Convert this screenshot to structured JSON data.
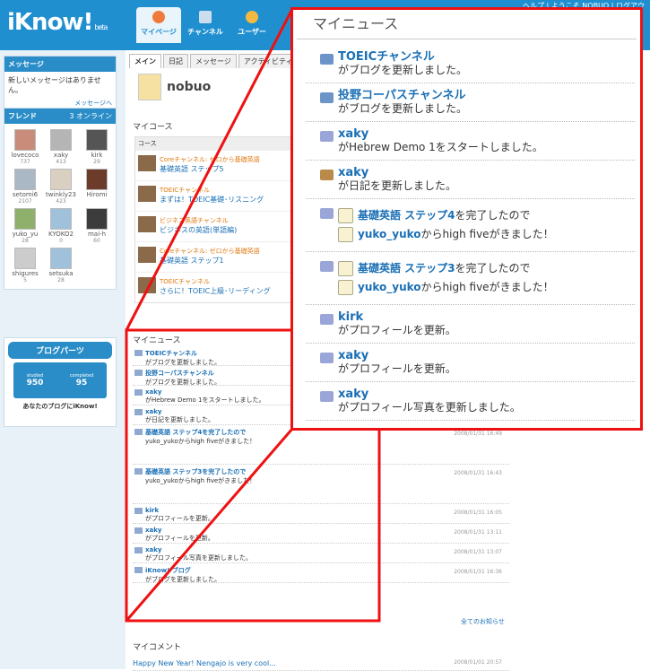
{
  "header": {
    "logo": "iKnow!",
    "beta": "beta",
    "top_links": "ヘルプ | ようこそ NOBUO | ログアウ",
    "tabs": [
      {
        "label": "マイページ",
        "active": true
      },
      {
        "label": "チャンネル",
        "active": false
      },
      {
        "label": "ユーザー",
        "active": false
      }
    ]
  },
  "sidebar": {
    "messages": {
      "title": "メッセージ",
      "text": "新しいメッセージはありません。",
      "link": "メッセージへ"
    },
    "friends": {
      "title": "フレンド",
      "online": "3 オンライン",
      "list": [
        {
          "name": "lovecoco",
          "count": "737"
        },
        {
          "name": "xaky",
          "count": "413"
        },
        {
          "name": "kirk",
          "count": "29"
        },
        {
          "name": "setomi6",
          "count": "2107"
        },
        {
          "name": "twinkly23",
          "count": "423"
        },
        {
          "name": "Hiromi",
          "count": ""
        },
        {
          "name": "yuko_yu",
          "count": "28"
        },
        {
          "name": "KYOKO2",
          "count": "0"
        },
        {
          "name": "mai-h",
          "count": "60"
        },
        {
          "name": "shigures",
          "count": "5"
        },
        {
          "name": "setsuka",
          "count": "28"
        }
      ]
    },
    "blogparts": {
      "title": "ブログパーツ",
      "studied_label": "studied",
      "studied": "950",
      "completed_label": "completed",
      "completed": "95",
      "footer": "あなたのブログにiKnow!"
    }
  },
  "main": {
    "subtabs": [
      "メイン",
      "日記",
      "メッセージ",
      "アクティビティ"
    ],
    "username": "nobuo",
    "mycourse": {
      "title": "マイコース",
      "header": "コース",
      "courses": [
        {
          "channel": "Coreチャンネル: ゼロから基礎英語",
          "title": "基礎英語 ステップ5"
        },
        {
          "channel": "TOEICチャンネル",
          "title": "まずは！TOEIC基礎･リスニング"
        },
        {
          "channel": "ビジネス英語チャンネル",
          "title": "ビジネスの英語(単語編)"
        },
        {
          "channel": "Coreチャンネル: ゼロから基礎英語",
          "title": "基礎英語 ステップ1"
        },
        {
          "channel": "TOEICチャンネル",
          "title": "さらに！TOEIC上級･リーディング"
        }
      ]
    },
    "mynews": {
      "title": "マイニュース",
      "items": [
        {
          "who": "TOEICチャンネル",
          "text": "がブログを更新しました。",
          "date": ""
        },
        {
          "who": "投野コーパスチャンネル",
          "text": "がブログを更新しました。",
          "date": ""
        },
        {
          "who": "xaky",
          "text": "がHebrew Demo 1をスタートしました。",
          "date": ""
        },
        {
          "who": "xaky",
          "text": "が日記を更新しました。",
          "date": ""
        },
        {
          "who": "基礎英語 ステップ4を完了したので",
          "text": "yuko_yukoからhigh fiveがきました！",
          "date": "2008/01/31 16:49"
        },
        {
          "who": "基礎英語 ステップ3を完了したので",
          "text": "yuko_yukoからhigh fiveがきました！",
          "date": "2008/01/31 16:43"
        },
        {
          "who": "kirk",
          "text": "がプロフィールを更新。",
          "date": "2008/01/31 16:05"
        },
        {
          "who": "xaky",
          "text": "がプロフィールを更新。",
          "date": "2008/01/31 13:11"
        },
        {
          "who": "xaky",
          "text": "がプロフィール写真を更新しました。",
          "date": "2008/01/31 13:07"
        },
        {
          "who": "iKnow! ブログ",
          "text": "がブログを更新しました。",
          "date": "2008/01/31 16:36"
        }
      ],
      "all_link": "全てのお知らせ"
    },
    "mycomment": {
      "title": "マイコメント",
      "items": [
        {
          "text": "Happy New Year! Nengajo is very cool...",
          "date": "2008/01/01 20:57"
        }
      ]
    }
  },
  "zoom": {
    "title": "マイニュース",
    "items": [
      {
        "icon": "blog",
        "who": "TOEICチャンネル",
        "text": "がブログを更新しました。"
      },
      {
        "icon": "blog",
        "who": "投野コーパスチャンネル",
        "text": "がブログを更新しました。"
      },
      {
        "icon": "mail",
        "who": "xaky",
        "text": "がHebrew Demo 1をスタートしました。"
      },
      {
        "icon": "diary",
        "who": "xaky",
        "text": "が日記を更新しました。"
      }
    ],
    "hf1": {
      "course": "基礎英語 ステップ4",
      "done": "を完了したので",
      "from": "yuko_yuko",
      "rest": "からhigh fiveがきました！"
    },
    "hf2": {
      "course": "基礎英語 ステップ3",
      "done": "を完了したので",
      "from": "yuko_yuko",
      "rest": "からhigh fiveがきました！"
    },
    "items2": [
      {
        "icon": "mail",
        "who": "kirk",
        "text": "がプロフィールを更新。"
      },
      {
        "icon": "mail",
        "who": "xaky",
        "text": "がプロフィールを更新。"
      },
      {
        "icon": "mail",
        "who": "xaky",
        "text": "がプロフィール写真を更新しました。"
      }
    ]
  }
}
